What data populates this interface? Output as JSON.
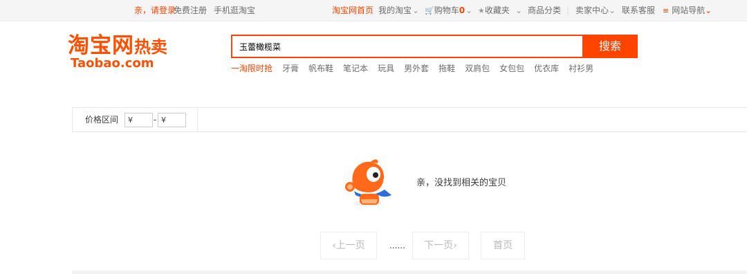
{
  "topbar": {
    "greeting_login": "亲，请登录",
    "register": "免费注册",
    "mobile": "手机逛淘宝",
    "home": "淘宝网首页",
    "my_taobao": "我的淘宝",
    "cart_label": "购物车",
    "cart_count": "0",
    "favorites": "收藏夹",
    "categories": "商品分类",
    "seller_center": "卖家中心",
    "contact": "联系客服",
    "site_nav": "网站导航"
  },
  "logo": {
    "cn": "淘宝网",
    "hot": "热卖",
    "en": "Taobao.com"
  },
  "search": {
    "value": "玉蕾橄榄菜",
    "button": "搜索"
  },
  "hotwords": [
    "一淘限时抢",
    "牙膏",
    "帆布鞋",
    "笔记本",
    "玩具",
    "男外套",
    "拖鞋",
    "双肩包",
    "女包包",
    "优衣库",
    "衬衫男"
  ],
  "filter": {
    "label": "价格区间",
    "min_prefix": "¥",
    "max_prefix": "¥",
    "dash": "-"
  },
  "empty": {
    "message": "亲，没找到相关的宝贝"
  },
  "pager": {
    "prev": "上一页",
    "ellipsis": "......",
    "next": "下一页",
    "first": "首页"
  },
  "colors": {
    "brand": "#ff4400",
    "border": "#e8e8e8",
    "muted": "#b8b8b8"
  },
  "icons": [
    "cart-icon",
    "star-icon",
    "menu-icon",
    "chevron-down-icon",
    "chevron-left-icon",
    "chevron-right-icon",
    "mascot-icon"
  ]
}
